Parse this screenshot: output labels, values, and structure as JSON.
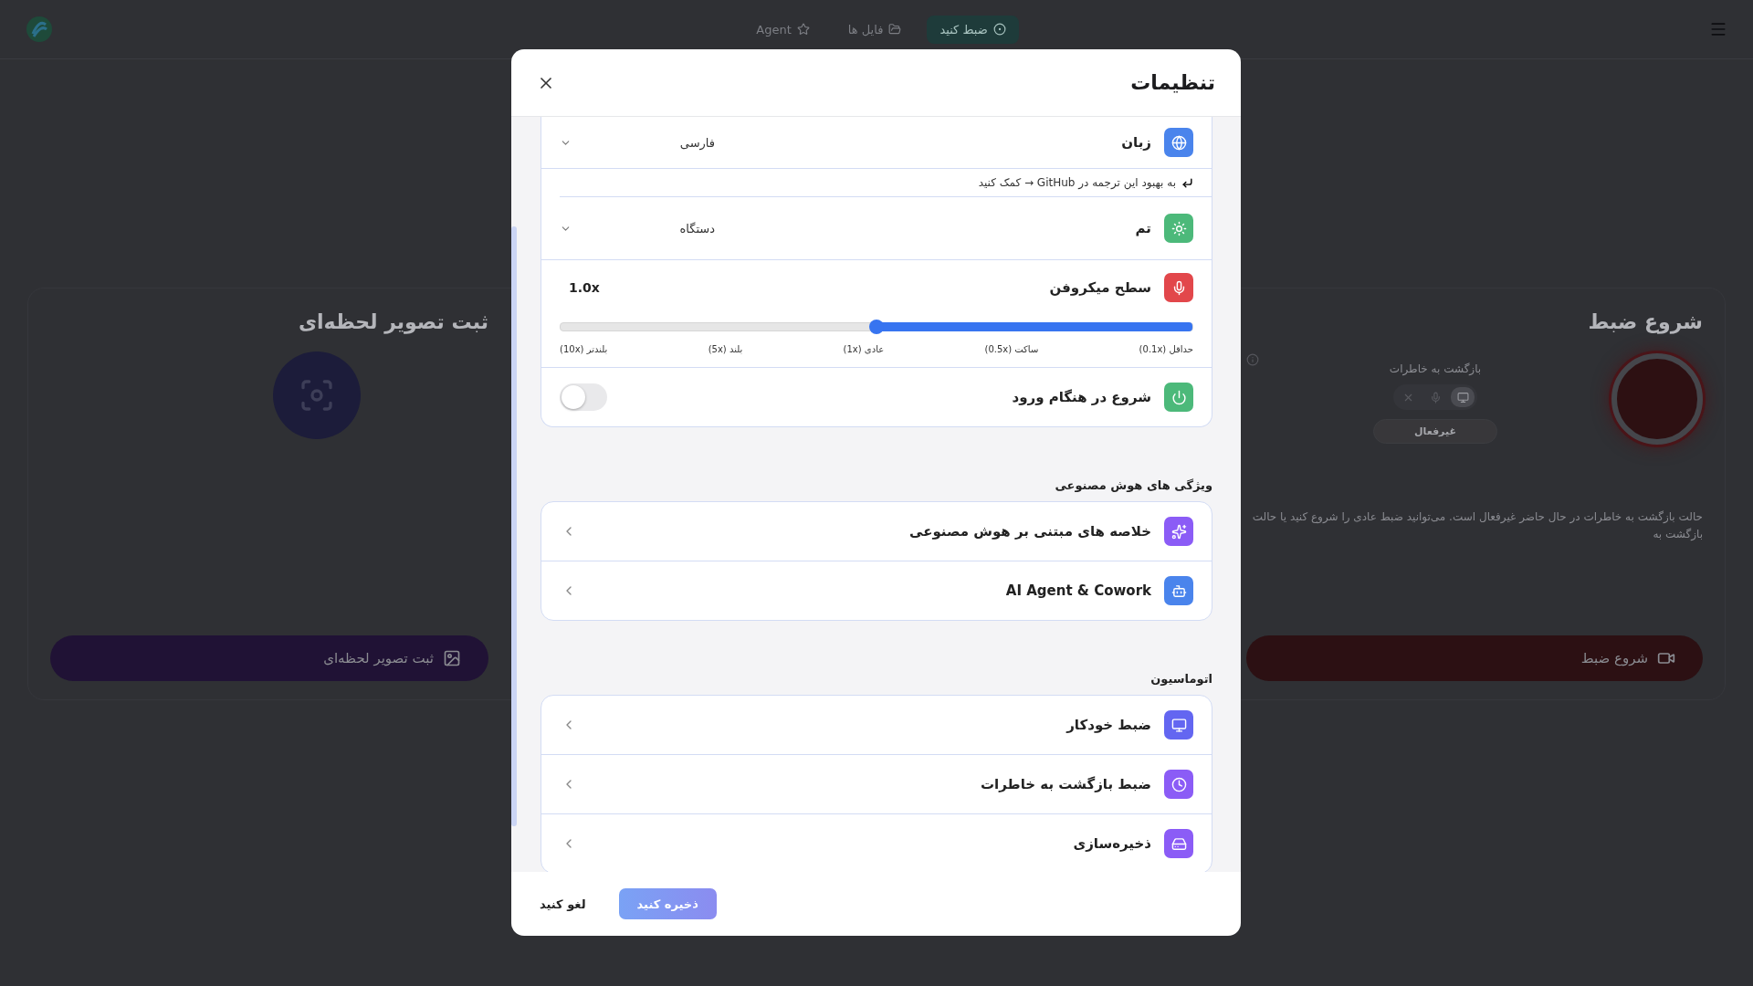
{
  "header": {
    "nav": [
      {
        "kind": "record",
        "label": "ضبط کنید",
        "selected": true
      },
      {
        "kind": "files",
        "label": "فایل ها",
        "selected": false
      },
      {
        "kind": "agent",
        "label": "Agent",
        "selected": false
      }
    ]
  },
  "background": {
    "record_card": {
      "title": "شروع ضبط",
      "rewind_label": "بازگشت به خاطرات",
      "rewind_modes": [
        {
          "kind": "screen",
          "selected": true
        },
        {
          "kind": "mic",
          "selected": false
        },
        {
          "kind": "off",
          "selected": false
        }
      ],
      "status": "غیرفعال",
      "note": "حالت بازگشت به خاطرات در حال حاضر غیرفعال است. می‌توانید ضبط عادی را شروع کنید یا حالت بازگشت به",
      "button": "شروع ضبط"
    },
    "capture_card": {
      "title": "ثبت تصویر لحظه‌ای",
      "button": "ثبت تصویر لحظه‌ای"
    }
  },
  "dialog": {
    "title": "تنظیمات",
    "general": [
      {
        "kind": "select",
        "color": "#4a84ec",
        "label": "زبان",
        "value": "فارسی"
      },
      {
        "kind": "link",
        "text": "به بهبود این ترجمه در GitHub → کمک کنید"
      },
      {
        "kind": "select",
        "color": "#4cb97a",
        "label": "تم",
        "value": "دستگاه"
      },
      {
        "kind": "slider",
        "color": "#e2474b",
        "label": "سطح میکروفن",
        "reading": "1.0x",
        "level": 0.5,
        "ticks": [
          "حداقل (0.1x)",
          "ساکت (0.5x)",
          "عادی (1x)",
          "بلند (5x)",
          "بلندتر (10x)"
        ]
      },
      {
        "kind": "toggle",
        "color": "#4cb97a",
        "label": "شروع در هنگام ورود",
        "on": false
      }
    ],
    "sections": [
      {
        "title": "ویژگی های هوش مصنوعی",
        "items": [
          {
            "color": "#8b5cf6",
            "label": "خلاصه های مبتنی بر هوش مصنوعی"
          },
          {
            "color": "#4a84ec",
            "label": "AI Agent & Cowork"
          }
        ]
      },
      {
        "title": "اتوماسیون",
        "items": [
          {
            "color": "#6366f1",
            "label": "ضبط خودکار"
          },
          {
            "color": "#8b5cf6",
            "label": "ضبط بازگشت به خاطرات"
          },
          {
            "color": "#8b5cf6",
            "label": "ذخیره‌سازی"
          }
        ]
      }
    ],
    "buttons": {
      "save": "ذخیره کنید",
      "cancel": "لغو کنید"
    }
  }
}
